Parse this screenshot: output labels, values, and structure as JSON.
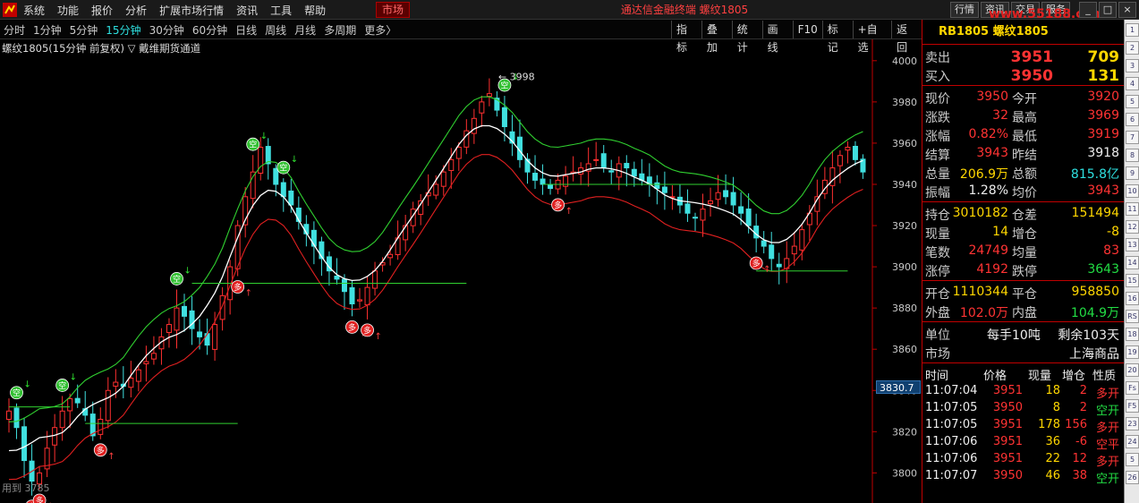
{
  "menubar": {
    "items": [
      "系统",
      "功能",
      "报价",
      "分析",
      "扩展市场行情",
      "资讯",
      "工具",
      "帮助"
    ],
    "market_button": "市场",
    "title": "通达信金融终端  螺纹1805",
    "right_buttons": [
      "行情",
      "资讯",
      "交易",
      "服务"
    ],
    "watermark": "www.55188.com"
  },
  "toolbar": {
    "periods": [
      "分时",
      "1分钟",
      "5分钟",
      "15分钟",
      "30分钟",
      "60分钟",
      "日线",
      "周线",
      "月线",
      "多周期",
      "更多〉"
    ],
    "active_period": "15分钟",
    "tools": [
      "指标",
      "叠加",
      "统计",
      "画线",
      "F10",
      "标记",
      "+自选",
      "返回"
    ]
  },
  "chart": {
    "caption": "螺纹1805(15分钟 前复权) ▽ 戴维期货通道",
    "peak_label": "3998",
    "current_axis_value": "3830.7",
    "footer_note": "用到 3785",
    "signal_long": "多",
    "signal_short": "空",
    "colors": {
      "up": "#ff3030",
      "down": "#40e0e0",
      "upper_band": "#30d030",
      "lower_band": "#e02020",
      "mid": "#ffffff",
      "support": "#30d030"
    },
    "chart_data": {
      "type": "candlestick",
      "title": "",
      "y_ticks": [
        4000,
        3980,
        3960,
        3940,
        3920,
        3900,
        3880,
        3860,
        3840,
        3820,
        3800
      ],
      "ylim": [
        3788,
        4006
      ],
      "close": [
        3830,
        3822,
        3806,
        3796,
        3800,
        3812,
        3822,
        3830,
        3836,
        3834,
        3828,
        3818,
        3826,
        3840,
        3844,
        3842,
        3846,
        3850,
        3854,
        3858,
        3866,
        3872,
        3880,
        3876,
        3870,
        3866,
        3862,
        3872,
        3886,
        3900,
        3920,
        3934,
        3946,
        3958,
        3950,
        3940,
        3934,
        3930,
        3922,
        3916,
        3910,
        3904,
        3898,
        3894,
        3888,
        3882,
        3884,
        3890,
        3898,
        3902,
        3906,
        3914,
        3920,
        3928,
        3932,
        3936,
        3940,
        3946,
        3952,
        3958,
        3966,
        3972,
        3980,
        3984,
        3976,
        3968,
        3960,
        3952,
        3946,
        3942,
        3940,
        3938,
        3942,
        3944,
        3946,
        3948,
        3950,
        3952,
        3948,
        3946,
        3950,
        3948,
        3944,
        3942,
        3940,
        3938,
        3936,
        3934,
        3930,
        3926,
        3924,
        3928,
        3932,
        3936,
        3934,
        3930,
        3926,
        3920,
        3914,
        3910,
        3904,
        3900,
        3904,
        3910,
        3918,
        3926,
        3934,
        3942,
        3948,
        3954,
        3958,
        3952,
        3946
      ],
      "long_signals": [
        3,
        4,
        12,
        30,
        45,
        47,
        72,
        98
      ],
      "short_signals": [
        1,
        7,
        22,
        32,
        36,
        65
      ],
      "support_levels": [
        3832,
        3824,
        3892,
        3940,
        3898
      ]
    }
  },
  "quote": {
    "header": "RB1805 螺纹1805",
    "ask": {
      "label": "卖出",
      "price": "3951",
      "vol": "709"
    },
    "bid": {
      "label": "买入",
      "price": "3950",
      "vol": "131"
    },
    "rows": [
      {
        "l1": "现价",
        "v1": "3950",
        "c1": "red",
        "l2": "今开",
        "v2": "3920",
        "c2": "red"
      },
      {
        "l1": "涨跌",
        "v1": "32",
        "c1": "red",
        "l2": "最高",
        "v2": "3969",
        "c2": "red"
      },
      {
        "l1": "涨幅",
        "v1": "0.82%",
        "c1": "red",
        "l2": "最低",
        "v2": "3919",
        "c2": "red"
      },
      {
        "l1": "结算",
        "v1": "3943",
        "c1": "red",
        "l2": "昨结",
        "v2": "3918",
        "c2": "white"
      },
      {
        "l1": "总量",
        "v1": "206.9万",
        "c1": "yellow",
        "l2": "总额",
        "v2": "815.8亿",
        "c2": "cyan"
      },
      {
        "l1": "振幅",
        "v1": "1.28%",
        "c1": "white",
        "l2": "均价",
        "v2": "3943",
        "c2": "red"
      }
    ],
    "rows2": [
      {
        "l1": "持仓",
        "v1": "3010182",
        "c1": "yellow",
        "l2": "仓差",
        "v2": "151494",
        "c2": "yellow"
      },
      {
        "l1": "现量",
        "v1": "14",
        "c1": "yellow",
        "l2": "增仓",
        "v2": "-8",
        "c2": "yellow"
      },
      {
        "l1": "笔数",
        "v1": "24749",
        "c1": "red",
        "l2": "均量",
        "v2": "83",
        "c2": "red"
      },
      {
        "l1": "涨停",
        "v1": "4192",
        "c1": "red",
        "l2": "跌停",
        "v2": "3643",
        "c2": "green"
      }
    ],
    "rows3": [
      {
        "l1": "开仓",
        "v1": "1110344",
        "c1": "yellow",
        "l2": "平仓",
        "v2": "958850",
        "c2": "yellow"
      },
      {
        "l1": "外盘",
        "v1": "102.0万",
        "c1": "red",
        "l2": "内盘",
        "v2": "104.9万",
        "c2": "green"
      }
    ],
    "unit": {
      "label": "单位",
      "value": "每手10吨",
      "remain": "剩余103天"
    },
    "market": {
      "label": "市场",
      "value": "上海商品"
    },
    "ticks_header": [
      "时间",
      "价格",
      "现量",
      "增仓",
      "性质"
    ],
    "ticks": [
      {
        "t": "11:07:04",
        "p": "3951",
        "v": "18",
        "d": "2",
        "n": "多开",
        "nc": "red"
      },
      {
        "t": "11:07:05",
        "p": "3950",
        "v": "8",
        "d": "2",
        "n": "空开",
        "nc": "green"
      },
      {
        "t": "11:07:05",
        "p": "3951",
        "v": "178",
        "d": "156",
        "n": "多开",
        "nc": "red"
      },
      {
        "t": "11:07:06",
        "p": "3951",
        "v": "36",
        "d": "-6",
        "n": "空平",
        "nc": "red"
      },
      {
        "t": "11:07:06",
        "p": "3951",
        "v": "22",
        "d": "12",
        "n": "多开",
        "nc": "red"
      },
      {
        "t": "11:07:07",
        "p": "3950",
        "v": "46",
        "d": "38",
        "n": "空开",
        "nc": "green"
      }
    ]
  },
  "sidecol": [
    "1",
    "2",
    "3",
    "4",
    "5",
    "6",
    "7",
    "8",
    "9",
    "10",
    "11",
    "12",
    "13",
    "14",
    "15",
    "16",
    "RS",
    "18",
    "19",
    "20",
    "Fs",
    "F5",
    "23",
    "24",
    "5",
    "26"
  ]
}
